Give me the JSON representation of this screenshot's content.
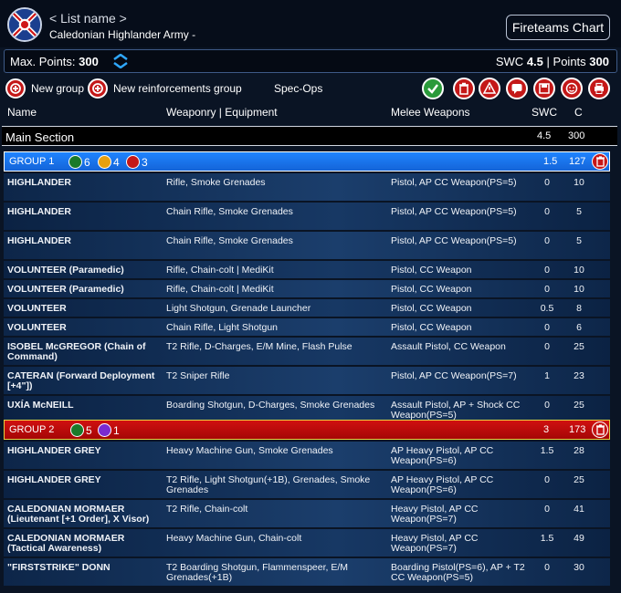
{
  "header": {
    "list_name": "< List name >",
    "army_name": "Caledonian Highlander Army -",
    "fireteams_button": "Fireteams Chart"
  },
  "points": {
    "max_label": "Max. Points:",
    "max_value": "300",
    "swc_label": "SWC",
    "swc_value": "4.5",
    "separator": "|",
    "points_label": "Points",
    "points_value": "300"
  },
  "toolbar": {
    "new_group": "New group",
    "new_reinforcements_group": "New reinforcements group",
    "spec_ops": "Spec-Ops",
    "actions": [
      "validate-icon",
      "delete-list-icon",
      "warning-icon",
      "chat-icon",
      "save-icon",
      "face-icon",
      "print-icon"
    ]
  },
  "columns": {
    "name": "Name",
    "weaponry": "Weaponry | Equipment",
    "melee": "Melee Weapons",
    "swc": "SWC",
    "cost": "C"
  },
  "main_section": {
    "title": "Main Section",
    "swc": "4.5",
    "cost": "300"
  },
  "groups": [
    {
      "name": "GROUP 1",
      "color": "#1f84ff",
      "orders": [
        {
          "icon": "regular-order-icon",
          "count": "6",
          "color": "#1a7a2a"
        },
        {
          "icon": "impetuous-order-icon",
          "count": "4",
          "color": "#e8a010"
        },
        {
          "icon": "irregular-order-icon",
          "count": "3",
          "color": "#c41818"
        }
      ],
      "swc": "1.5",
      "cost": "127",
      "troopers": [
        {
          "name": "HIGHLANDER",
          "weapons": "Rifle, Smoke Grenades",
          "melee": "Pistol, AP CC Weapon(PS=5)",
          "swc": "0",
          "cost": "10"
        },
        {
          "name": "HIGHLANDER",
          "weapons": "Chain Rifle, Smoke Grenades",
          "melee": "Pistol, AP CC Weapon(PS=5)",
          "swc": "0",
          "cost": "5"
        },
        {
          "name": "HIGHLANDER",
          "weapons": "Chain Rifle, Smoke Grenades",
          "melee": "Pistol, AP CC Weapon(PS=5)",
          "swc": "0",
          "cost": "5"
        },
        {
          "name": "VOLUNTEER (Paramedic)",
          "weapons": "Rifle, Chain-colt | MediKit",
          "melee": "Pistol, CC Weapon",
          "swc": "0",
          "cost": "10"
        },
        {
          "name": "VOLUNTEER (Paramedic)",
          "weapons": "Rifle, Chain-colt | MediKit",
          "melee": "Pistol, CC Weapon",
          "swc": "0",
          "cost": "10"
        },
        {
          "name": "VOLUNTEER",
          "weapons": "Light Shotgun, Grenade Launcher",
          "melee": "Pistol, CC Weapon",
          "swc": "0.5",
          "cost": "8"
        },
        {
          "name": "VOLUNTEER",
          "weapons": "Chain Rifle, Light Shotgun",
          "melee": "Pistol, CC Weapon",
          "swc": "0",
          "cost": "6"
        },
        {
          "name": "ISOBEL McGREGOR (Chain of Command)",
          "weapons": "T2 Rifle, D-Charges, E/M Mine, Flash Pulse",
          "melee": "Assault Pistol, CC Weapon",
          "swc": "0",
          "cost": "25"
        },
        {
          "name": "CATERAN (Forward Deployment [+4\"])",
          "weapons": "T2 Sniper Rifle",
          "melee": "Pistol, AP CC Weapon(PS=7)",
          "swc": "1",
          "cost": "23"
        },
        {
          "name": "UXÍA McNEILL",
          "weapons": "Boarding Shotgun, D-Charges, Smoke Grenades",
          "melee": "Assault Pistol, AP + Shock CC Weapon(PS=5)",
          "swc": "0",
          "cost": "25"
        }
      ]
    },
    {
      "name": "GROUP 2",
      "color": "#d01010",
      "orders": [
        {
          "icon": "regular-order-icon",
          "count": "5",
          "color": "#1a7a2a"
        },
        {
          "icon": "lieutenant-order-icon",
          "count": "1",
          "color": "#7a2ad0"
        }
      ],
      "swc": "3",
      "cost": "173",
      "troopers": [
        {
          "name": "HIGHLANDER GREY",
          "weapons": "Heavy Machine Gun, Smoke Grenades",
          "melee": "AP Heavy Pistol, AP CC Weapon(PS=6)",
          "swc": "1.5",
          "cost": "28"
        },
        {
          "name": "HIGHLANDER GREY",
          "weapons": "T2 Rifle, Light Shotgun(+1B), Grenades, Smoke Grenades",
          "melee": "AP Heavy Pistol, AP CC Weapon(PS=6)",
          "swc": "0",
          "cost": "25"
        },
        {
          "name": "CALEDONIAN MORMAER (Lieutenant [+1 Order], X Visor)",
          "weapons": "T2 Rifle, Chain-colt",
          "melee": "Heavy Pistol, AP CC Weapon(PS=7)",
          "swc": "0",
          "cost": "41"
        },
        {
          "name": "CALEDONIAN MORMAER (Tactical Awareness)",
          "weapons": "Heavy Machine Gun, Chain-colt",
          "melee": "Heavy Pistol, AP CC Weapon(PS=7)",
          "swc": "1.5",
          "cost": "49"
        },
        {
          "name": "\"FIRSTSTRIKE\" DONN",
          "weapons": "T2 Boarding Shotgun, Flammenspeer, E/M Grenades(+1B)",
          "melee": "Boarding Pistol(PS=6), AP + T2 CC Weapon(PS=5)",
          "swc": "0",
          "cost": "30"
        }
      ]
    }
  ]
}
